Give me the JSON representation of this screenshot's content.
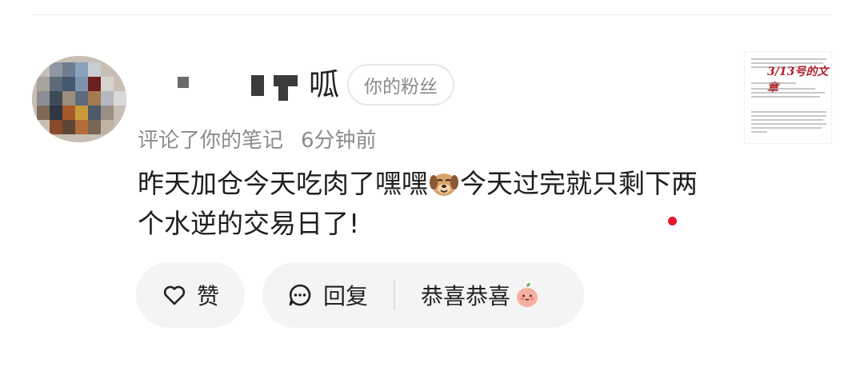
{
  "user": {
    "name_visible_char": "呱",
    "fan_badge": "你的粉丝"
  },
  "meta": {
    "action": "评论了你的笔记",
    "time": "6分钟前"
  },
  "comment": {
    "part1": "昨天加仓今天吃肉了嘿嘿",
    "emoji1": "dog-emoji",
    "part2": "今天过完就只剩下两个水逆的交易日了!"
  },
  "thumbnail": {
    "handwriting": "3/13号的文章"
  },
  "actions": {
    "like_label": "赞",
    "reply_label": "回复",
    "quick_reply_label": "恭喜恭喜",
    "quick_reply_emoji": "peach-emoji"
  },
  "colors": {
    "accent_red": "#e8142a",
    "pill_bg": "#f4f4f4",
    "meta_text": "#8c8c8c"
  }
}
